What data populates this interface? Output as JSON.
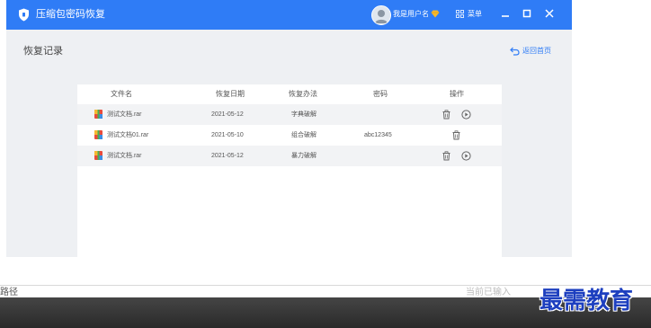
{
  "app": {
    "title": "压缩包密码恢复",
    "username": "我是用户名",
    "menu_label": "菜单"
  },
  "page": {
    "title": "恢复记录",
    "back_label": "返回首页"
  },
  "table": {
    "headers": {
      "file": "文件名",
      "date": "恢复日期",
      "method": "恢复办法",
      "password": "密码",
      "actions": "操作"
    },
    "rows": [
      {
        "file": "测试文档.rar",
        "date": "2021-05-12",
        "method": "字典破解",
        "password": "",
        "actions": [
          "delete-icon",
          "play-icon"
        ]
      },
      {
        "file": "测试文档01.rar",
        "date": "2021-05-10",
        "method": "组合破解",
        "password": "abc12345",
        "actions": [
          "delete-icon"
        ]
      },
      {
        "file": "测试文档.rar",
        "date": "2021-05-12",
        "method": "暴力破解",
        "password": "",
        "actions": [
          "delete-icon",
          "play-icon"
        ]
      }
    ]
  },
  "external": {
    "left_text": "路径",
    "right_text": "当前已输入",
    "watermark": "最需教育"
  },
  "colors": {
    "brand": "#2f7cf6",
    "content_bg": "#eef0f3",
    "row_alt": "#f2f3f5",
    "watermark": "#1d3fbf"
  }
}
